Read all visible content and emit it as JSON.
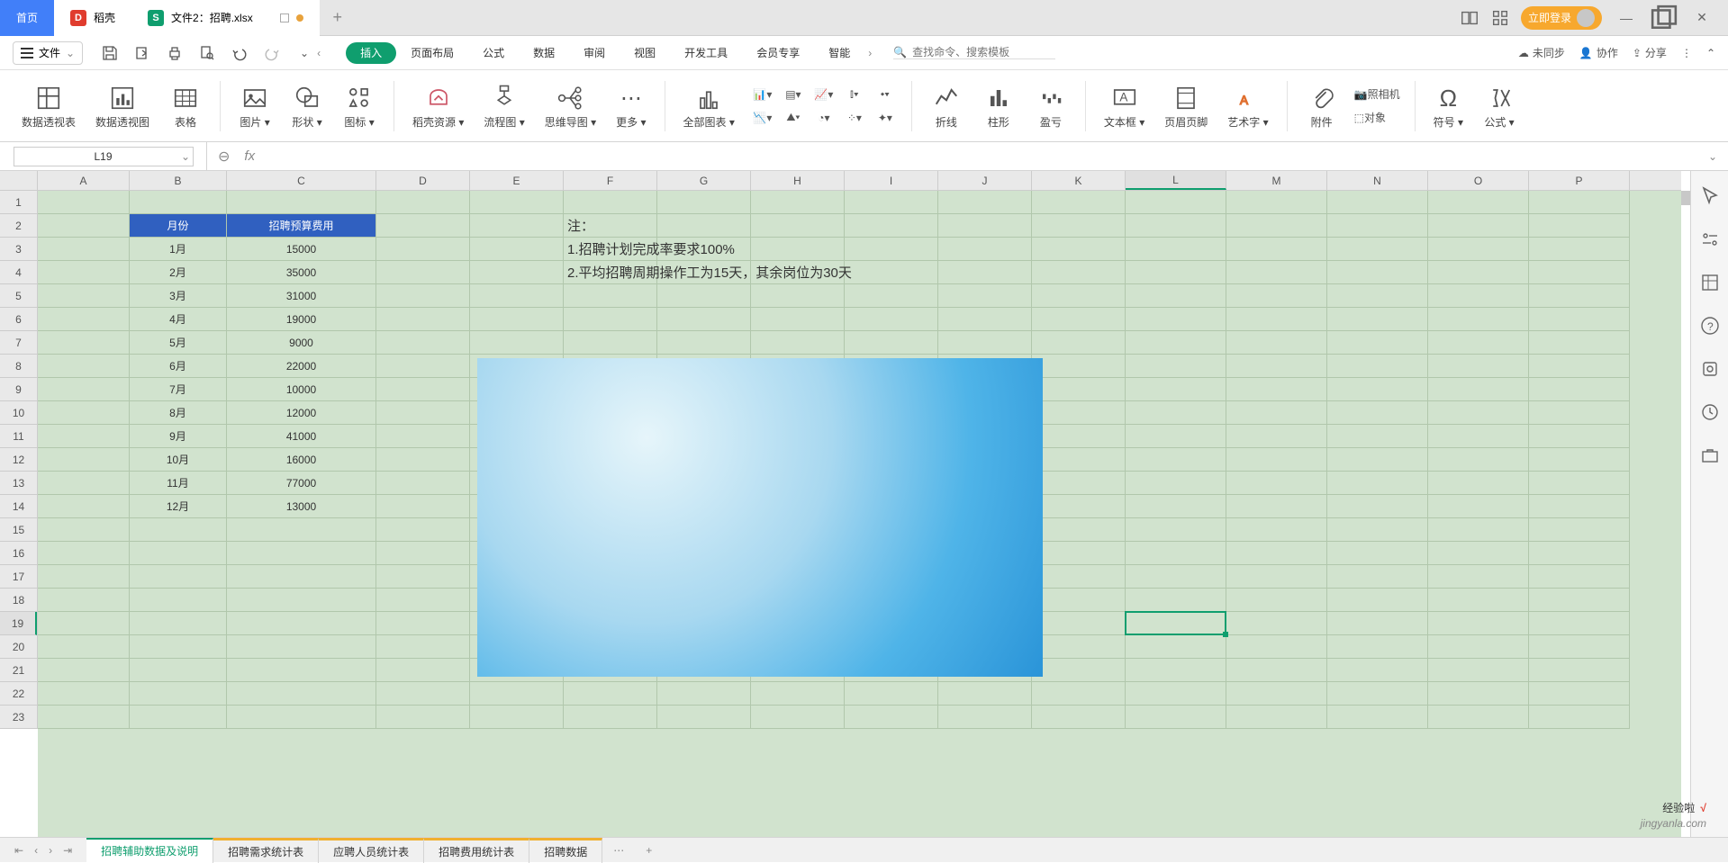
{
  "title": {
    "tab_home": "首页",
    "tab_dao": "稻壳",
    "tab_doc": "文件2：招聘.xlsx",
    "login": "立即登录"
  },
  "file_menu": {
    "label": "文件"
  },
  "menutabs": {
    "items": [
      "页面布局",
      "公式",
      "数据",
      "审阅",
      "视图",
      "开发工具",
      "会员专享",
      "智能"
    ],
    "active": "插入"
  },
  "search": {
    "placeholder": "查找命令、搜索模板"
  },
  "menu_right": {
    "unsync": "未同步",
    "collab": "协作",
    "share": "分享"
  },
  "ribbon": {
    "pivot_table": "数据透视表",
    "pivot_chart": "数据透视图",
    "table": "表格",
    "pic": "图片",
    "shape": "形状",
    "icon": "图标",
    "daores": "稻壳资源",
    "flow": "流程图",
    "mindmap": "思维导图",
    "more": "更多",
    "allcharts": "全部图表",
    "spark_line": "折线",
    "spark_col": "柱形",
    "spark_wl": "盈亏",
    "textbox": "文本框",
    "headerfooter": "页眉页脚",
    "wordart": "艺术字",
    "attach": "附件",
    "object": "对象",
    "camera": "照相机",
    "symbol": "符号",
    "formula": "公式"
  },
  "namebox": "L19",
  "columns": [
    "A",
    "B",
    "C",
    "D",
    "E",
    "F",
    "G",
    "H",
    "I",
    "J",
    "K",
    "L",
    "M",
    "N",
    "O",
    "P"
  ],
  "rownums": [
    "1",
    "2",
    "3",
    "4",
    "5",
    "6",
    "7",
    "8",
    "9",
    "10",
    "11",
    "12",
    "13",
    "14",
    "15",
    "16",
    "17",
    "18",
    "19",
    "20",
    "21",
    "22",
    "23"
  ],
  "headers": {
    "month": "月份",
    "budget": "招聘预算费用"
  },
  "chart_data": {
    "type": "table",
    "categories": [
      "1月",
      "2月",
      "3月",
      "4月",
      "5月",
      "6月",
      "7月",
      "8月",
      "9月",
      "10月",
      "11月",
      "12月"
    ],
    "values": [
      15000,
      35000,
      31000,
      19000,
      9000,
      22000,
      10000,
      12000,
      41000,
      16000,
      77000,
      13000
    ],
    "title": "招聘预算费用",
    "xlabel": "月份",
    "ylabel": "招聘预算费用",
    "ylim": [
      0,
      80000
    ]
  },
  "notes": {
    "title": "注：",
    "n1": "1.招聘计划完成率要求100%",
    "n2": "2.平均招聘周期操作工为15天，其余岗位为30天"
  },
  "sheets": {
    "active": "招聘辅助数据及说明",
    "items": [
      "招聘需求统计表",
      "应聘人员统计表",
      "招聘费用统计表",
      "招聘数据"
    ]
  },
  "watermark": {
    "l1a": "经验啦",
    "l1b": "√",
    "l2": "jingyanla.com"
  }
}
